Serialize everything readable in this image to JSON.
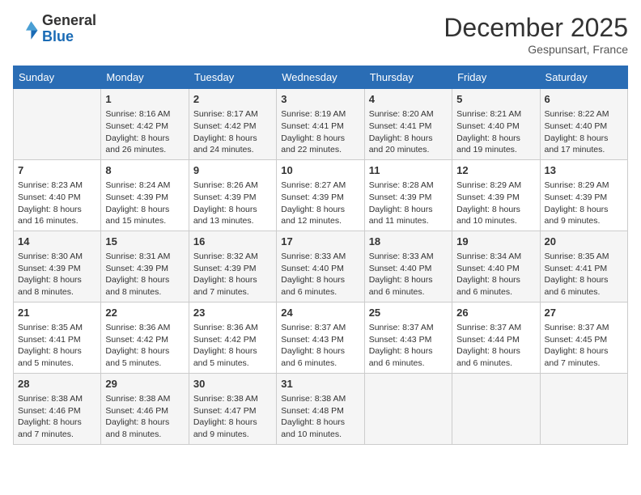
{
  "header": {
    "logo_general": "General",
    "logo_blue": "Blue",
    "month_title": "December 2025",
    "location": "Gespunsart, France"
  },
  "weekdays": [
    "Sunday",
    "Monday",
    "Tuesday",
    "Wednesday",
    "Thursday",
    "Friday",
    "Saturday"
  ],
  "weeks": [
    [
      {
        "day": "",
        "info": ""
      },
      {
        "day": "1",
        "info": "Sunrise: 8:16 AM\nSunset: 4:42 PM\nDaylight: 8 hours\nand 26 minutes."
      },
      {
        "day": "2",
        "info": "Sunrise: 8:17 AM\nSunset: 4:42 PM\nDaylight: 8 hours\nand 24 minutes."
      },
      {
        "day": "3",
        "info": "Sunrise: 8:19 AM\nSunset: 4:41 PM\nDaylight: 8 hours\nand 22 minutes."
      },
      {
        "day": "4",
        "info": "Sunrise: 8:20 AM\nSunset: 4:41 PM\nDaylight: 8 hours\nand 20 minutes."
      },
      {
        "day": "5",
        "info": "Sunrise: 8:21 AM\nSunset: 4:40 PM\nDaylight: 8 hours\nand 19 minutes."
      },
      {
        "day": "6",
        "info": "Sunrise: 8:22 AM\nSunset: 4:40 PM\nDaylight: 8 hours\nand 17 minutes."
      }
    ],
    [
      {
        "day": "7",
        "info": "Sunrise: 8:23 AM\nSunset: 4:40 PM\nDaylight: 8 hours\nand 16 minutes."
      },
      {
        "day": "8",
        "info": "Sunrise: 8:24 AM\nSunset: 4:39 PM\nDaylight: 8 hours\nand 15 minutes."
      },
      {
        "day": "9",
        "info": "Sunrise: 8:26 AM\nSunset: 4:39 PM\nDaylight: 8 hours\nand 13 minutes."
      },
      {
        "day": "10",
        "info": "Sunrise: 8:27 AM\nSunset: 4:39 PM\nDaylight: 8 hours\nand 12 minutes."
      },
      {
        "day": "11",
        "info": "Sunrise: 8:28 AM\nSunset: 4:39 PM\nDaylight: 8 hours\nand 11 minutes."
      },
      {
        "day": "12",
        "info": "Sunrise: 8:29 AM\nSunset: 4:39 PM\nDaylight: 8 hours\nand 10 minutes."
      },
      {
        "day": "13",
        "info": "Sunrise: 8:29 AM\nSunset: 4:39 PM\nDaylight: 8 hours\nand 9 minutes."
      }
    ],
    [
      {
        "day": "14",
        "info": "Sunrise: 8:30 AM\nSunset: 4:39 PM\nDaylight: 8 hours\nand 8 minutes."
      },
      {
        "day": "15",
        "info": "Sunrise: 8:31 AM\nSunset: 4:39 PM\nDaylight: 8 hours\nand 8 minutes."
      },
      {
        "day": "16",
        "info": "Sunrise: 8:32 AM\nSunset: 4:39 PM\nDaylight: 8 hours\nand 7 minutes."
      },
      {
        "day": "17",
        "info": "Sunrise: 8:33 AM\nSunset: 4:40 PM\nDaylight: 8 hours\nand 6 minutes."
      },
      {
        "day": "18",
        "info": "Sunrise: 8:33 AM\nSunset: 4:40 PM\nDaylight: 8 hours\nand 6 minutes."
      },
      {
        "day": "19",
        "info": "Sunrise: 8:34 AM\nSunset: 4:40 PM\nDaylight: 8 hours\nand 6 minutes."
      },
      {
        "day": "20",
        "info": "Sunrise: 8:35 AM\nSunset: 4:41 PM\nDaylight: 8 hours\nand 6 minutes."
      }
    ],
    [
      {
        "day": "21",
        "info": "Sunrise: 8:35 AM\nSunset: 4:41 PM\nDaylight: 8 hours\nand 5 minutes."
      },
      {
        "day": "22",
        "info": "Sunrise: 8:36 AM\nSunset: 4:42 PM\nDaylight: 8 hours\nand 5 minutes."
      },
      {
        "day": "23",
        "info": "Sunrise: 8:36 AM\nSunset: 4:42 PM\nDaylight: 8 hours\nand 5 minutes."
      },
      {
        "day": "24",
        "info": "Sunrise: 8:37 AM\nSunset: 4:43 PM\nDaylight: 8 hours\nand 6 minutes."
      },
      {
        "day": "25",
        "info": "Sunrise: 8:37 AM\nSunset: 4:43 PM\nDaylight: 8 hours\nand 6 minutes."
      },
      {
        "day": "26",
        "info": "Sunrise: 8:37 AM\nSunset: 4:44 PM\nDaylight: 8 hours\nand 6 minutes."
      },
      {
        "day": "27",
        "info": "Sunrise: 8:37 AM\nSunset: 4:45 PM\nDaylight: 8 hours\nand 7 minutes."
      }
    ],
    [
      {
        "day": "28",
        "info": "Sunrise: 8:38 AM\nSunset: 4:46 PM\nDaylight: 8 hours\nand 7 minutes."
      },
      {
        "day": "29",
        "info": "Sunrise: 8:38 AM\nSunset: 4:46 PM\nDaylight: 8 hours\nand 8 minutes."
      },
      {
        "day": "30",
        "info": "Sunrise: 8:38 AM\nSunset: 4:47 PM\nDaylight: 8 hours\nand 9 minutes."
      },
      {
        "day": "31",
        "info": "Sunrise: 8:38 AM\nSunset: 4:48 PM\nDaylight: 8 hours\nand 10 minutes."
      },
      {
        "day": "",
        "info": ""
      },
      {
        "day": "",
        "info": ""
      },
      {
        "day": "",
        "info": ""
      }
    ]
  ]
}
